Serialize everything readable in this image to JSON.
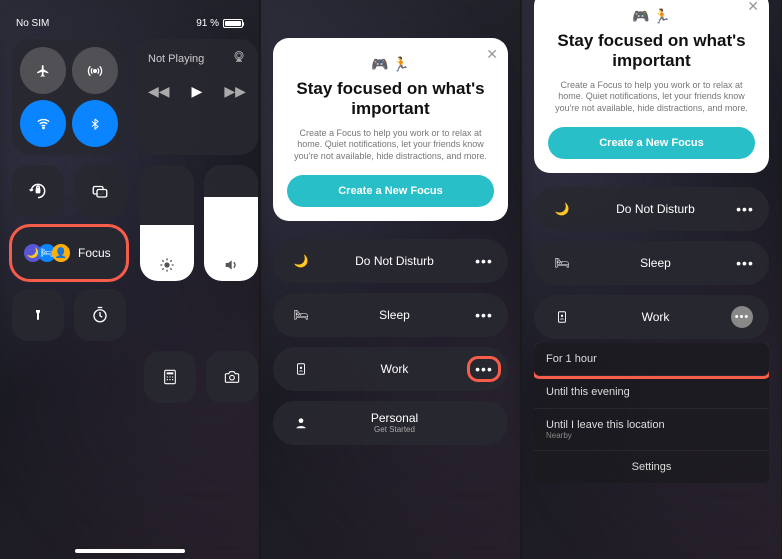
{
  "panel1": {
    "status": {
      "carrier": "No SIM",
      "battery_pct": "91 %"
    },
    "music": {
      "title": "Not Playing"
    },
    "focus_tile_label": "Focus"
  },
  "card": {
    "title": "Stay focused on what's important",
    "desc": "Create a Focus to help you work or to relax at home. Quiet notifications, let your friends know you're not available, hide distractions, and more.",
    "button": "Create a New Focus"
  },
  "focus_items": {
    "dnd": "Do Not Disturb",
    "sleep": "Sleep",
    "work": "Work",
    "personal": "Personal",
    "personal_sub": "Get Started"
  },
  "work_options": {
    "for1hour": "For 1 hour",
    "until_evening": "Until this evening",
    "until_leave": "Until I leave this location",
    "until_leave_sub": "Nearby",
    "settings": "Settings"
  }
}
